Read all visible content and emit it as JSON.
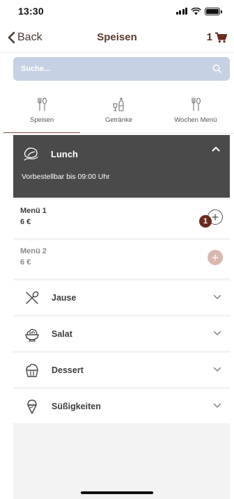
{
  "status_bar": {
    "time": "13:30"
  },
  "nav": {
    "back_label": "Back",
    "title": "Speisen",
    "cart_count": "1"
  },
  "search": {
    "placeholder": "Suche..."
  },
  "tabs": [
    {
      "label": "Speisen",
      "icon": "fork-spoon-icon",
      "active": true
    },
    {
      "label": "Getränke",
      "icon": "glass-bottle-icon",
      "active": false
    },
    {
      "label": "Wochen Menü",
      "icon": "fork-spoon-icon",
      "active": false
    }
  ],
  "lunch": {
    "title": "Lunch",
    "icon": "hat-icon",
    "subtitle": "Vorbestellbar bis 09:00 Uhr",
    "items": [
      {
        "name": "Menü 1",
        "price": "6 €",
        "quantity": "1",
        "enabled": true
      },
      {
        "name": "Menü 2",
        "price": "6 €",
        "enabled": false
      }
    ]
  },
  "categories": [
    {
      "label": "Jause",
      "icon": "fork-spoon-crossed-icon"
    },
    {
      "label": "Salat",
      "icon": "salad-bowl-icon"
    },
    {
      "label": "Dessert",
      "icon": "cupcake-icon"
    },
    {
      "label": "Süßigkeiten",
      "icon": "ice-cream-icon"
    }
  ],
  "colors": {
    "accent": "#6b2b1e",
    "search_bg": "#c6d1e3",
    "header_bg": "#4a4a4a"
  }
}
